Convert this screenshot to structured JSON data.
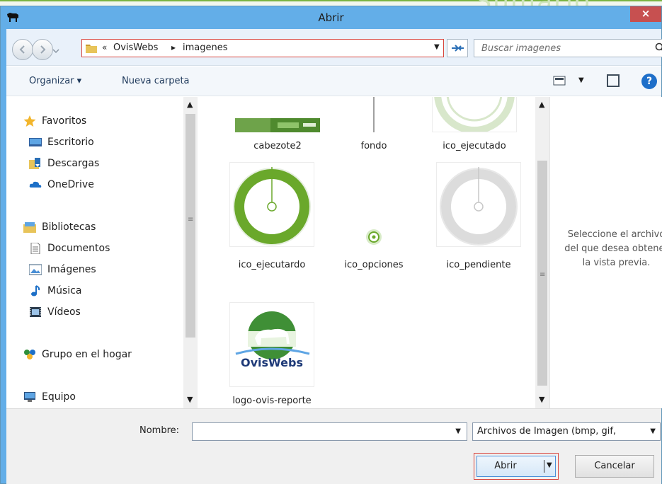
{
  "background": {
    "deco_text": "Sumario"
  },
  "window": {
    "title": "Abrir",
    "close_glyph": "×",
    "accent": "#63aee8"
  },
  "address": {
    "chevron": "«",
    "crumbs": [
      "OvisWebs",
      "imagenes"
    ],
    "separator": "▸",
    "dropdown": "▼"
  },
  "search": {
    "placeholder": "Buscar imagenes"
  },
  "commandbar": {
    "organize": "Organizar ▾",
    "new_folder": "Nueva carpeta",
    "view_dropdown": "▼",
    "help": "?"
  },
  "nav": {
    "items": [
      {
        "label": "Favoritos",
        "icon": "star-icon"
      },
      {
        "label": "Escritorio",
        "icon": "desktop-icon"
      },
      {
        "label": "Descargas",
        "icon": "downloads-icon"
      },
      {
        "label": "OneDrive",
        "icon": "cloud-icon"
      },
      {
        "label": "Bibliotecas",
        "icon": "library-icon"
      },
      {
        "label": "Documentos",
        "icon": "document-icon"
      },
      {
        "label": "Imágenes",
        "icon": "pictures-icon"
      },
      {
        "label": "Música",
        "icon": "music-icon"
      },
      {
        "label": "Vídeos",
        "icon": "video-icon"
      },
      {
        "label": "Grupo en el hogar",
        "icon": "homegroup-icon"
      },
      {
        "label": "Equipo",
        "icon": "computer-icon"
      }
    ]
  },
  "files": [
    {
      "name": "cabezote2"
    },
    {
      "name": "fondo"
    },
    {
      "name": "ico_ejecutado"
    },
    {
      "name": "ico_ejecutardo"
    },
    {
      "name": "ico_opciones"
    },
    {
      "name": "ico_pendiente"
    },
    {
      "name": "logo-ovis-reporte",
      "logo_text": "OvisWebs"
    }
  ],
  "preview": {
    "message": "Seleccione el archivo\ndel que desea obtener\nla vista previa."
  },
  "bottom": {
    "name_label": "Nombre:",
    "name_value": "",
    "filter_value": "Archivos de Imagen (bmp, gif,",
    "dropdown": "▼",
    "open_label": "Abrir",
    "cancel_label": "Cancelar"
  },
  "scrollbar": {
    "up": "▲",
    "down": "▼",
    "grip": "≡"
  }
}
